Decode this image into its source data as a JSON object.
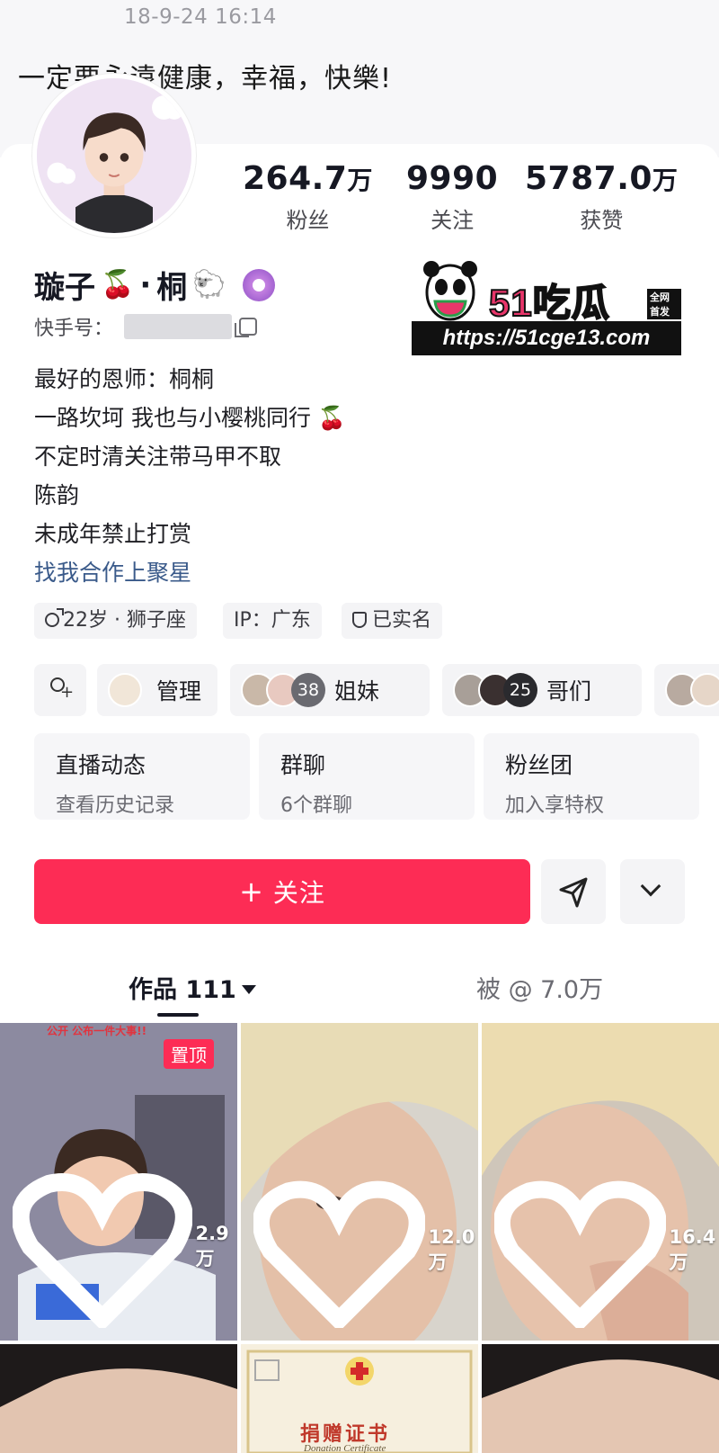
{
  "cover": {
    "date": "18-9-24 16:14",
    "text": "一定要永遠健康，幸福，快樂!"
  },
  "profile": {
    "name_part1": "璇子",
    "name_sep": "·",
    "name_part2": "桐",
    "kuaishou_label": "快手号：",
    "stats": [
      {
        "value": "264.7",
        "unit": "万",
        "label": "粉丝"
      },
      {
        "value": "9990",
        "unit": "",
        "label": "关注"
      },
      {
        "value": "5787.0",
        "unit": "万",
        "label": "获赞"
      }
    ],
    "bio": [
      "最好的恩师：桐桐",
      "一路坎坷 我也与小樱桃同行",
      "不定时清关注带马甲不取",
      "陈韵",
      "未成年禁止打赏"
    ],
    "bio_link": "找我合作上聚星",
    "tags": {
      "age": "22岁 · 狮子座",
      "ip": "IP：广东",
      "verified": "已实名"
    }
  },
  "watermark": {
    "logo": "51吃瓜",
    "tag": "全网首发",
    "url": "https://51cge13.com"
  },
  "groups": {
    "manage": "管理",
    "sisters_count": "38",
    "sisters": "姐妹",
    "bros_count": "25",
    "bros": "哥们"
  },
  "cards": [
    {
      "title": "直播动态",
      "sub": "查看历史记录"
    },
    {
      "title": "群聊",
      "sub": "6个群聊"
    },
    {
      "title": "粉丝团",
      "sub": "加入享特权"
    }
  ],
  "actions": {
    "follow": "关注"
  },
  "tabs": {
    "works_label": "作品",
    "works_count": "111",
    "mention": "被 @ 7.0万"
  },
  "grid": {
    "pinned": "置顶",
    "tile1_caption": "公开 公布一件大事!!",
    "likes": [
      "2.9万",
      "12.0万",
      "16.4万"
    ],
    "cert_title": "捐赠证书",
    "cert_sub": "Donation Certificate"
  },
  "colors": {
    "accent": "#fd2c55",
    "link": "#3a5a8a"
  }
}
